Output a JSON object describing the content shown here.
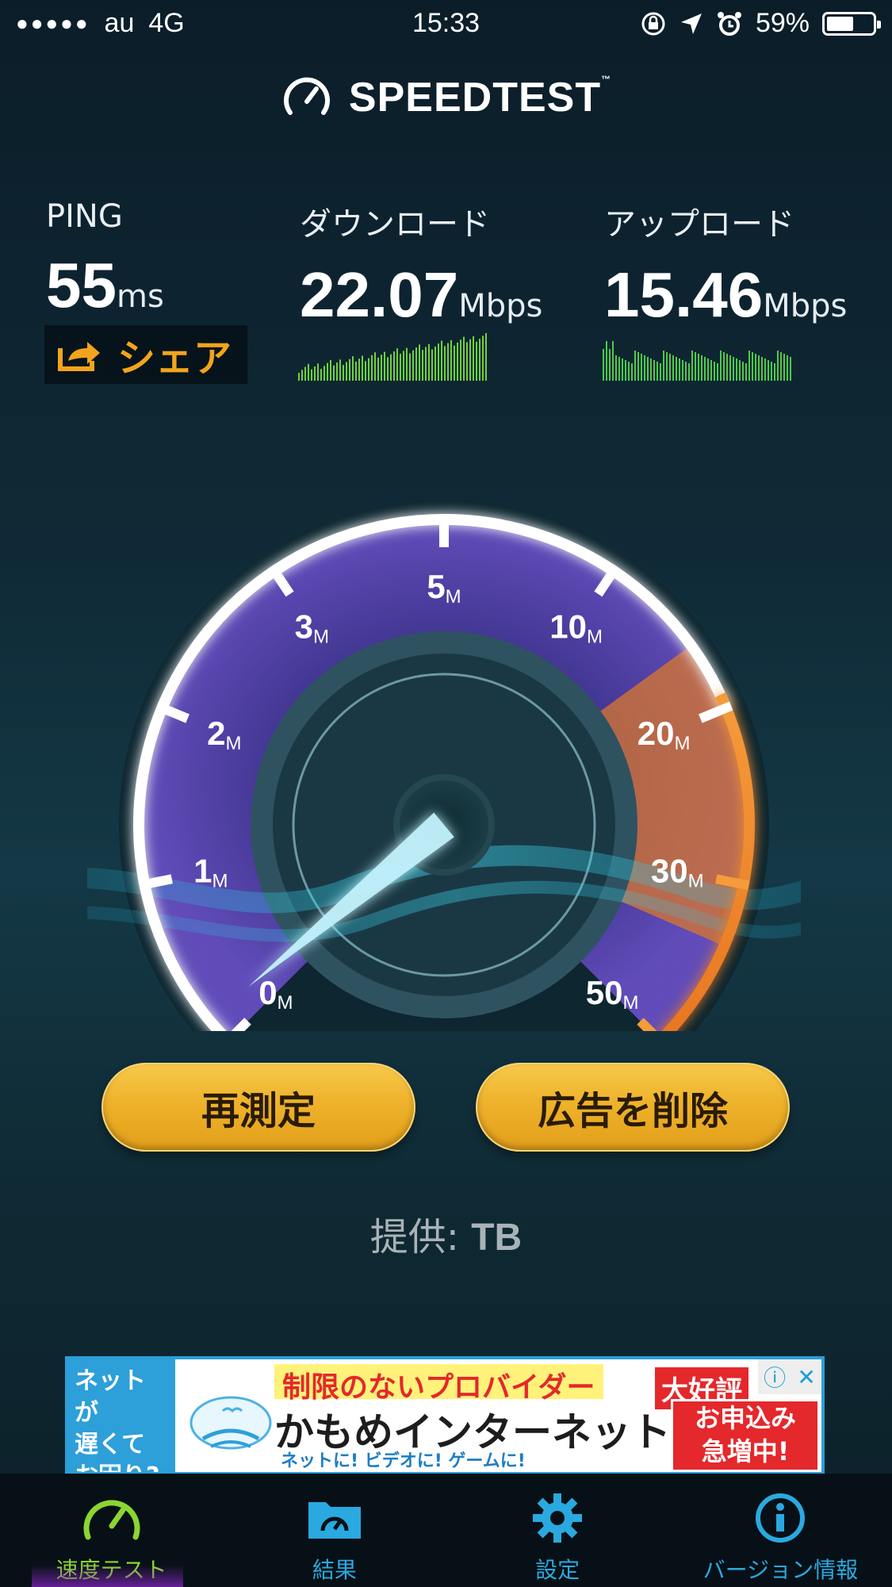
{
  "status_bar": {
    "signal_dots": "●●●●●",
    "carrier": "au",
    "network": "4G",
    "time": "15:33",
    "battery_percent": "59%",
    "battery_level": 0.59
  },
  "header": {
    "title": "SPEEDTEST",
    "trademark": "™"
  },
  "stats": {
    "ping": {
      "label": "PING",
      "value": "55",
      "unit": "ms"
    },
    "download": {
      "label": "ダウンロード",
      "value": "22.07",
      "unit": "Mbps"
    },
    "upload": {
      "label": "アップロード",
      "value": "15.46",
      "unit": "Mbps"
    }
  },
  "share": {
    "label": "シェア"
  },
  "gauge": {
    "scale_labels": [
      {
        "num": "0",
        "unit": "M"
      },
      {
        "num": "1",
        "unit": "M"
      },
      {
        "num": "2",
        "unit": "M"
      },
      {
        "num": "3",
        "unit": "M"
      },
      {
        "num": "5",
        "unit": "M"
      },
      {
        "num": "10",
        "unit": "M"
      },
      {
        "num": "20",
        "unit": "M"
      },
      {
        "num": "30",
        "unit": "M"
      },
      {
        "num": "50",
        "unit": "M"
      }
    ],
    "colors": {
      "accent_purple": "#6b4bc8",
      "accent_orange": "#f08a2c",
      "needle": "#bff3ff"
    }
  },
  "buttons": {
    "retest": "再測定",
    "remove_ads": "広告を削除"
  },
  "provider": {
    "label": "提供:",
    "name": "TB"
  },
  "ad": {
    "left_text": [
      "ネットが",
      "遅くて",
      "お困り?"
    ],
    "headline": "制限のないプロバイダー",
    "brand": "かもめインターネット",
    "sub": "ネットに! ビデオに! ゲームに!",
    "badge": "大好評",
    "promo": [
      "お申込み",
      "急増中!"
    ],
    "info_icon": "ⓘ",
    "close_icon": "✕"
  },
  "tabs": [
    {
      "label": "速度テスト",
      "icon": "speedometer-icon",
      "active": true
    },
    {
      "label": "結果",
      "icon": "results-folder-icon",
      "active": false
    },
    {
      "label": "設定",
      "icon": "gear-icon",
      "active": false
    },
    {
      "label": "バージョン情報",
      "icon": "info-icon",
      "active": false
    }
  ]
}
